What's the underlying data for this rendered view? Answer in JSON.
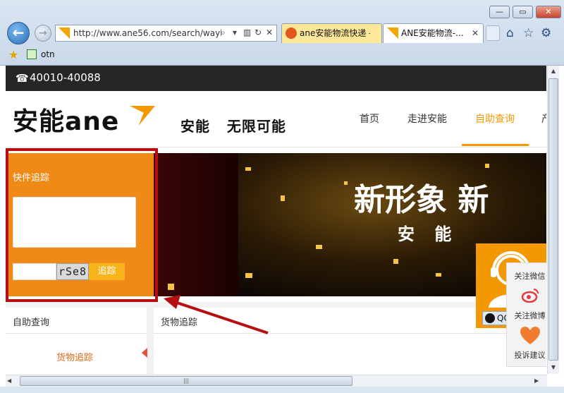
{
  "browser": {
    "address_url": "http://www.ane56.com/search/wayb",
    "tabs": [
      {
        "label": "ane安能物流快递 -..."
      },
      {
        "label": "ANE安能物流-..."
      }
    ],
    "favorites": [
      {
        "label": "otn"
      }
    ]
  },
  "site": {
    "phone": "40010-40088",
    "logo_text": "安能ane",
    "slogan": "安能   无限可能",
    "nav": [
      {
        "label": "首页"
      },
      {
        "label": "走进安能"
      },
      {
        "label": "自助查询",
        "active": true
      },
      {
        "label": "产"
      }
    ]
  },
  "banner": {
    "title": "新形象 新",
    "subtitle": "安 能"
  },
  "track_panel": {
    "title": "快件追踪",
    "textarea_value": "",
    "captcha_value": "",
    "captcha_text": "rSe8",
    "button_label": "追踪"
  },
  "bottom": {
    "left_title": "自助查询",
    "left_link": "货物追踪",
    "right_title": "货物追踪"
  },
  "qq_widget": {
    "button_label": "QQ交谈"
  },
  "side_float": {
    "items": [
      {
        "label": "关注微信",
        "icon": "wechat-icon"
      },
      {
        "label": "关注微博",
        "icon": "weibo-icon"
      },
      {
        "label": "投诉建议",
        "icon": "heart-icon"
      }
    ]
  },
  "colors": {
    "brand_orange": "#f39800",
    "panel_orange": "#ef8a17",
    "highlight_red": "#b50f12",
    "topbar_dark": "#262626"
  }
}
